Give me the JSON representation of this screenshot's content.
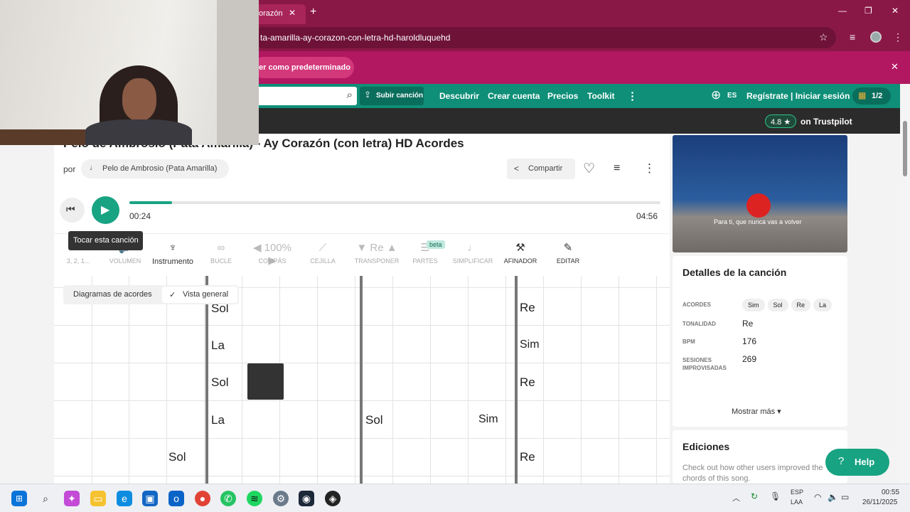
{
  "browser": {
    "tab_title": "orazón",
    "url": "ta-amarilla-ay-corazon-con-letra-hd-haroldluquehd",
    "infobar_text": "er como predeterminado"
  },
  "nav": {
    "upload": "Subir canción",
    "discover": "Descubrir",
    "create_account": "Crear cuenta",
    "prices": "Precios",
    "toolkit": "Toolkit",
    "language": "ES",
    "register": "Regístrate | Iniciar sesión",
    "gift": "1/2",
    "trust_score": "4.8 ★",
    "trust_text": "on Trustpilot"
  },
  "song": {
    "title": "Pelo de Ambrosio (Pata Amarilla) - Ay Corazón (con letra) HD Acordes",
    "by": "por",
    "artist": "Pelo de Ambrosio (Pata Amarilla)",
    "share": "Compartir",
    "time_current": "00:24",
    "time_total": "04:56",
    "progress": 0.08,
    "tooltip": "Tocar esta canción"
  },
  "toolbar": [
    {
      "icon": "↻",
      "label": "3, 2, 1..."
    },
    {
      "icon": "🔊",
      "label": "VOLUMEN"
    },
    {
      "icon": "♆",
      "label": "Instrumento"
    },
    {
      "icon": "∞",
      "label": "BUCLE"
    },
    {
      "icon": "◀ 100% ▶",
      "label": "COMPÁS"
    },
    {
      "icon": "⟋",
      "label": "CEJILLA"
    },
    {
      "icon": "▼ Re ▲",
      "label": "TRANSPONER"
    },
    {
      "icon": "☰",
      "label": "PARTES"
    },
    {
      "icon": "♩",
      "label": "SIMPLIFICAR"
    },
    {
      "icon": "⚒",
      "label": "AFINADOR"
    },
    {
      "icon": "✎",
      "label": "EDITAR"
    }
  ],
  "beta_badge": "beta",
  "view_toggle": {
    "diagrams": "Diagramas de acordes",
    "overview": "Vista general"
  },
  "chord_labels": {
    "sol": "Sol",
    "la": "La",
    "re": "Re",
    "sim": "Sim"
  },
  "video_caption": "Para ti, que nunca vas a volver",
  "details": {
    "title": "Detalles de la canción",
    "chords_label": "ACORDES",
    "chords": [
      "Sim",
      "Sol",
      "Re",
      "La"
    ],
    "key_label": "TONALIDAD",
    "key": "Re",
    "bpm_label": "BPM",
    "bpm": "176",
    "sessions_label": "SESIONES IMPROVISADAS",
    "sessions": "269",
    "more": "Mostrar más ▾"
  },
  "editions": {
    "title": "Ediciones",
    "text": "Check out how other users improved the chords of this song."
  },
  "help": "Help",
  "taskbar": {
    "lang": "ESP",
    "lang2": "LAA",
    "time": "00:55",
    "date": "26/11/2025"
  }
}
